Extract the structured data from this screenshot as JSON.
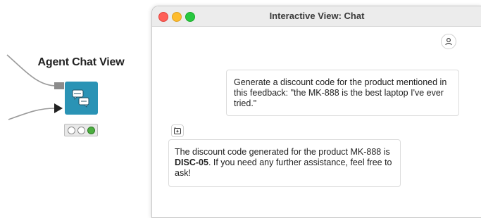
{
  "node": {
    "title": "Agent Chat View",
    "status": "executed"
  },
  "window": {
    "title": "Interactive View: Chat"
  },
  "chat": {
    "messages": [
      {
        "role": "user",
        "text": "Generate a discount code for the product mentioned in this feedback: \"the MK-888 is the best laptop I've ever tried.\""
      },
      {
        "role": "assistant",
        "text_before": "The discount code generated for the product MK-888 is ",
        "code": "DISC-05",
        "text_after": ". If you need any further assistance, feel free to ask!"
      }
    ]
  },
  "icons": {
    "user_avatar": "person-icon",
    "assistant_avatar": "sparkle-icon",
    "node_icon": "chat-bubbles-icon"
  },
  "colors": {
    "node": "#2a93b5",
    "traffic_green": "#4cae3f",
    "mac_red": "#ff5f57",
    "mac_yellow": "#febc2e",
    "mac_green": "#28c840"
  }
}
